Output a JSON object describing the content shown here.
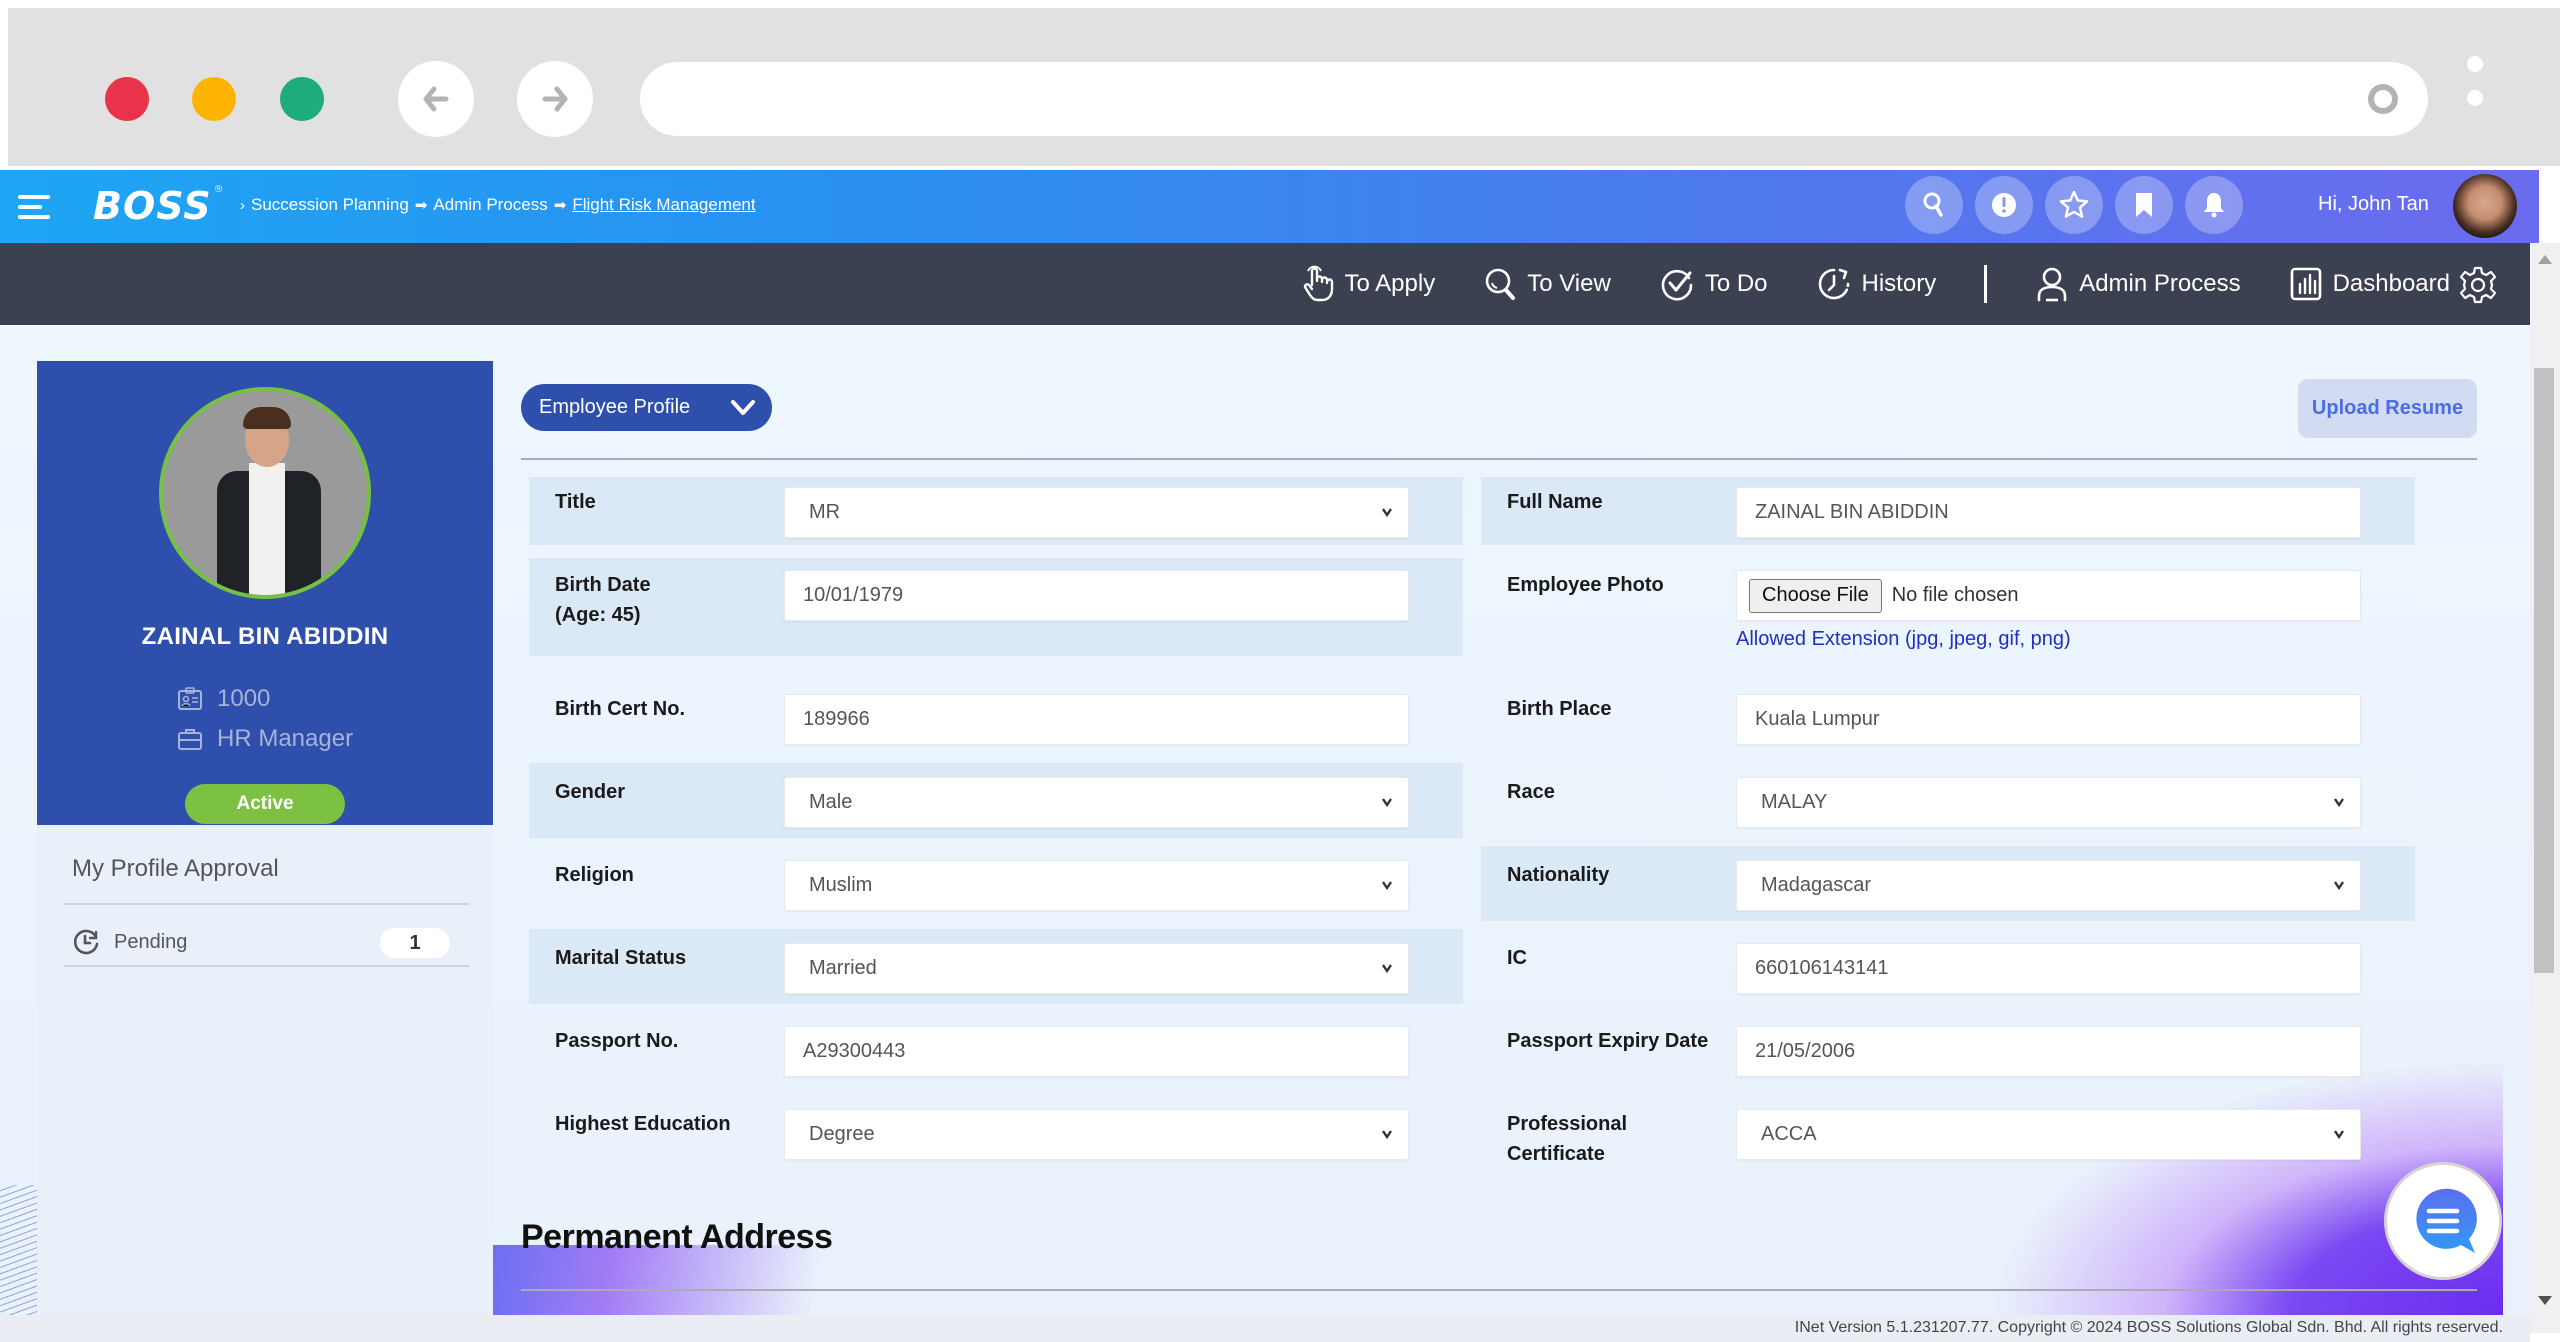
{
  "browser": {
    "back_icon": "arrow-left-icon",
    "forward_icon": "arrow-right-icon",
    "url": ""
  },
  "header": {
    "logo": "BOSS",
    "logo_mark": "®",
    "breadcrumb": {
      "lead_icon": "›",
      "items": [
        "Succession Planning",
        "Admin Process",
        "Flight Risk Management"
      ],
      "separator": "➡"
    },
    "icons": [
      "search-icon",
      "alert-icon",
      "star-icon",
      "bookmark-icon",
      "bell-icon"
    ],
    "greeting": "Hi, John Tan"
  },
  "nav": {
    "items": [
      {
        "label": "To Apply",
        "icon": "hand-pointer-icon"
      },
      {
        "label": "To View",
        "icon": "magnifier-icon"
      },
      {
        "label": "To Do",
        "icon": "check-circle-icon"
      },
      {
        "label": "History",
        "icon": "history-icon"
      },
      {
        "label": "Admin Process",
        "icon": "user-icon"
      },
      {
        "label": "Dashboard",
        "icon": "dashboard-icon"
      }
    ],
    "settings_icon": "gear-icon"
  },
  "profile": {
    "name": "ZAINAL BIN ABIDDIN",
    "employee_id": "1000",
    "position": "HR Manager",
    "status": "Active",
    "status_color": "#7cc142"
  },
  "approval": {
    "title": "My Profile Approval",
    "items": [
      {
        "label": "Pending",
        "count": "1"
      }
    ]
  },
  "form": {
    "section_selector": "Employee Profile",
    "upload_resume": "Upload Resume",
    "left_fields": [
      {
        "label": "Title",
        "value": "MR",
        "type": "select"
      },
      {
        "label": "Birth Date",
        "sublabel": "(Age: 45)",
        "value": "10/01/1979",
        "type": "text"
      },
      {
        "label": "Birth Cert No.",
        "value": "189966",
        "type": "text"
      },
      {
        "label": "Gender",
        "value": "Male",
        "type": "select"
      },
      {
        "label": "Religion",
        "value": "Muslim",
        "type": "select"
      },
      {
        "label": "Marital Status",
        "value": "Married",
        "type": "select"
      },
      {
        "label": "Passport No.",
        "value": "A29300443",
        "type": "text"
      },
      {
        "label": "Highest Education",
        "value": "Degree",
        "type": "select"
      }
    ],
    "right_fields": [
      {
        "label": "Full Name",
        "value": "ZAINAL BIN ABIDDIN",
        "type": "text"
      },
      {
        "label": "Employee Photo",
        "type": "file",
        "button": "Choose File",
        "status": "No file chosen",
        "hint": "Allowed Extension (jpg, jpeg, gif, png)"
      },
      {
        "label": "Birth Place",
        "value": "Kuala Lumpur",
        "type": "text"
      },
      {
        "label": "Race",
        "value": "MALAY",
        "type": "select"
      },
      {
        "label": "Nationality",
        "value": "Madagascar",
        "type": "select"
      },
      {
        "label": "IC",
        "value": "660106143141",
        "type": "text"
      },
      {
        "label": "Passport Expiry Date",
        "value": "21/05/2006",
        "type": "text"
      },
      {
        "label": "Professional Certificate",
        "value": "ACCA",
        "type": "select"
      }
    ],
    "next_section": "Permanent Address"
  },
  "footer": {
    "text": "INet Version 5.1.231207.77. Copyright © 2024 BOSS Solutions Global Sdn. Bhd. All rights reserved."
  },
  "chat": {
    "icon": "chat-bubble-icon"
  },
  "colors": {
    "header_start": "#1ea6f4",
    "header_end": "#6b6bee",
    "nav_bg": "#3c4152",
    "card_blue": "#2f4fad",
    "link_blue": "#1d2fc9"
  }
}
